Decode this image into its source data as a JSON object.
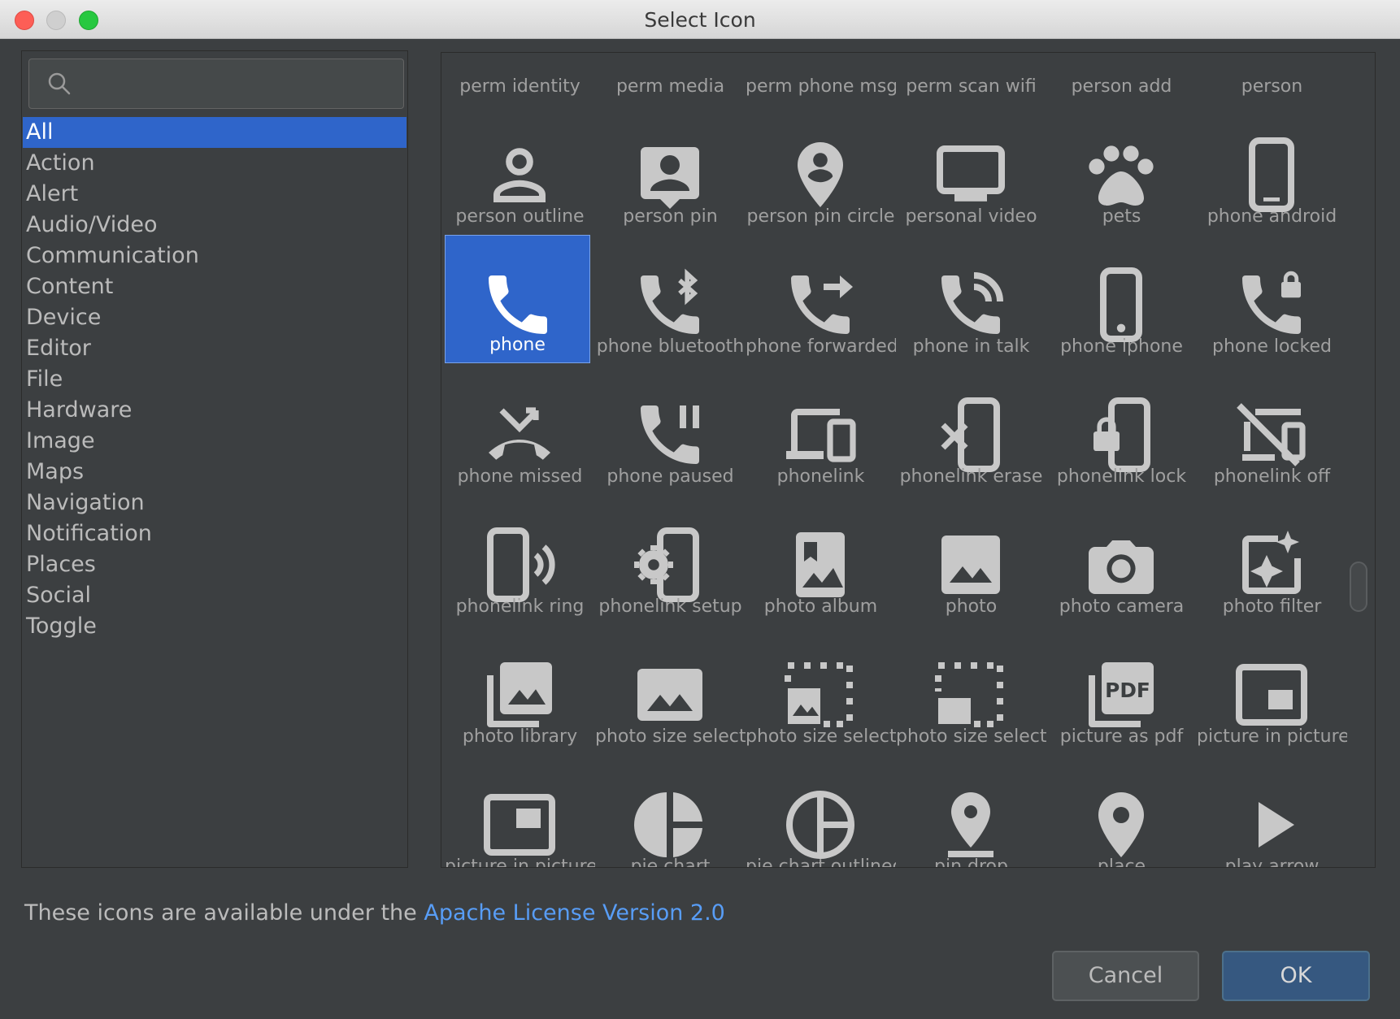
{
  "window": {
    "title": "Select Icon"
  },
  "search": {
    "value": "",
    "placeholder": ""
  },
  "categories": [
    {
      "label": "All",
      "selected": true
    },
    {
      "label": "Action"
    },
    {
      "label": "Alert"
    },
    {
      "label": "Audio/Video"
    },
    {
      "label": "Communication"
    },
    {
      "label": "Content"
    },
    {
      "label": "Device"
    },
    {
      "label": "Editor"
    },
    {
      "label": "File"
    },
    {
      "label": "Hardware"
    },
    {
      "label": "Image"
    },
    {
      "label": "Maps"
    },
    {
      "label": "Navigation"
    },
    {
      "label": "Notification"
    },
    {
      "label": "Places"
    },
    {
      "label": "Social"
    },
    {
      "label": "Toggle"
    }
  ],
  "icons": [
    {
      "label": "perm identity",
      "icon": "perm-identity-icon"
    },
    {
      "label": "perm media",
      "icon": "perm-media-icon"
    },
    {
      "label": "perm phone msg",
      "icon": "perm-phone-msg-icon"
    },
    {
      "label": "perm scan wifi",
      "icon": "perm-scan-wifi-icon"
    },
    {
      "label": "person add",
      "icon": "person-add-icon"
    },
    {
      "label": "person",
      "icon": "person-icon"
    },
    {
      "label": "person outline",
      "icon": "person-outline-icon"
    },
    {
      "label": "person pin",
      "icon": "person-pin-icon"
    },
    {
      "label": "person pin circle",
      "icon": "person-pin-circle-icon"
    },
    {
      "label": "personal video",
      "icon": "personal-video-icon"
    },
    {
      "label": "pets",
      "icon": "pets-icon"
    },
    {
      "label": "phone android",
      "icon": "phone-android-icon"
    },
    {
      "label": "phone",
      "icon": "phone-icon",
      "selected": true
    },
    {
      "label": "phone bluetooth",
      "icon": "phone-bluetooth-icon"
    },
    {
      "label": "phone forwarded",
      "icon": "phone-forwarded-icon"
    },
    {
      "label": "phone in talk",
      "icon": "phone-in-talk-icon"
    },
    {
      "label": "phone iphone",
      "icon": "phone-iphone-icon"
    },
    {
      "label": "phone locked",
      "icon": "phone-locked-icon"
    },
    {
      "label": "phone missed",
      "icon": "phone-missed-icon"
    },
    {
      "label": "phone paused",
      "icon": "phone-paused-icon"
    },
    {
      "label": "phonelink",
      "icon": "phonelink-icon"
    },
    {
      "label": "phonelink erase",
      "icon": "phonelink-erase-icon"
    },
    {
      "label": "phonelink lock",
      "icon": "phonelink-lock-icon"
    },
    {
      "label": "phonelink off",
      "icon": "phonelink-off-icon"
    },
    {
      "label": "phonelink ring",
      "icon": "phonelink-ring-icon"
    },
    {
      "label": "phonelink setup",
      "icon": "phonelink-setup-icon"
    },
    {
      "label": "photo album",
      "icon": "photo-album-icon"
    },
    {
      "label": "photo",
      "icon": "photo-icon"
    },
    {
      "label": "photo camera",
      "icon": "photo-camera-icon"
    },
    {
      "label": "photo filter",
      "icon": "photo-filter-icon"
    },
    {
      "label": "photo library",
      "icon": "photo-library-icon"
    },
    {
      "label": "photo size select",
      "icon": "photo-size-select-actual-icon"
    },
    {
      "label": "photo size select",
      "icon": "photo-size-select-large-icon"
    },
    {
      "label": "photo size select",
      "icon": "photo-size-select-small-icon"
    },
    {
      "label": "picture as pdf",
      "icon": "picture-as-pdf-icon"
    },
    {
      "label": "picture in picture",
      "icon": "picture-in-picture-icon"
    },
    {
      "label": "picture in picture",
      "icon": "picture-in-picture-alt-icon"
    },
    {
      "label": "pie chart",
      "icon": "pie-chart-icon"
    },
    {
      "label": "pie chart outlined",
      "icon": "pie-chart-outlined-icon"
    },
    {
      "label": "pin drop",
      "icon": "pin-drop-icon"
    },
    {
      "label": "place",
      "icon": "place-icon"
    },
    {
      "label": "play arrow",
      "icon": "play-arrow-icon"
    }
  ],
  "footer": {
    "license_prefix": "These icons are available under the ",
    "license_link": "Apache License Version 2.0"
  },
  "buttons": {
    "cancel": "Cancel",
    "ok": "OK"
  },
  "colors": {
    "accent": "#2f65ca",
    "link": "#589df6",
    "background": "#3c3f41",
    "icon": "#c8c8c8"
  }
}
